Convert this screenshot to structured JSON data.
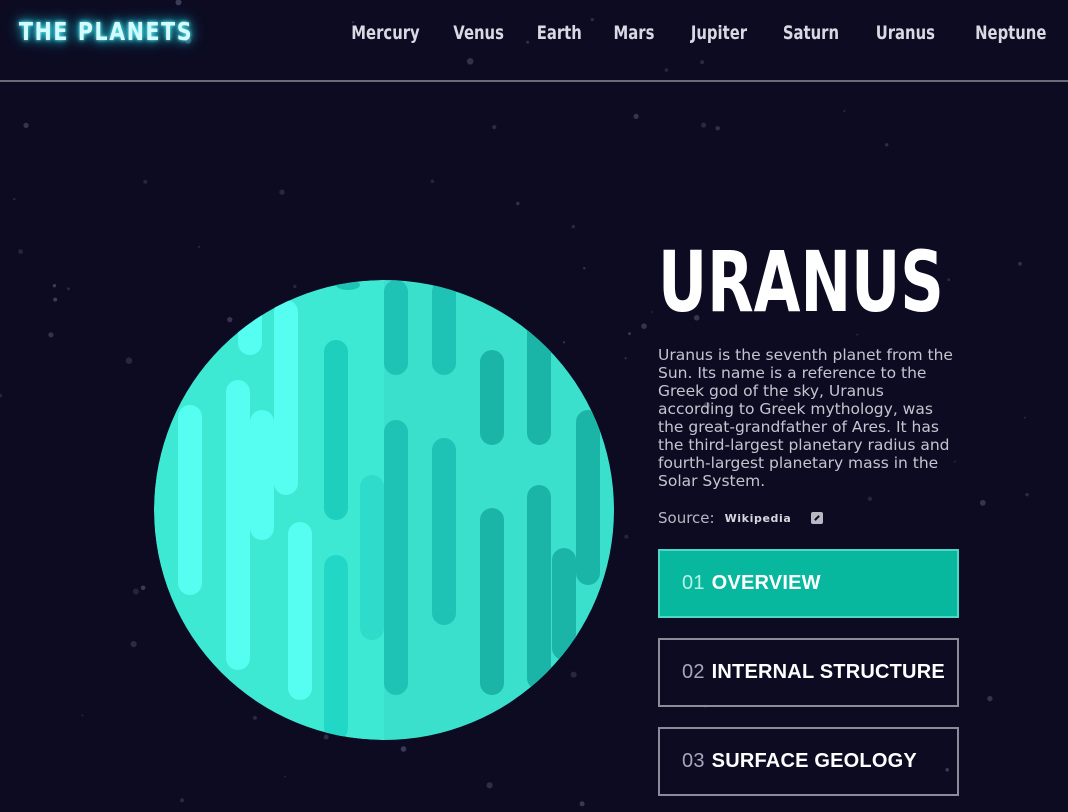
{
  "header": {
    "logo": "THE PLANETS",
    "nav": [
      "Mercury",
      "Venus",
      "Earth",
      "Mars",
      "Jupiter",
      "Saturn",
      "Uranus",
      "Neptune"
    ]
  },
  "planet": {
    "name": "URANUS",
    "description": "Uranus is the seventh planet from the Sun. Its name is a reference to the Greek god of the sky, Uranus according to Greek mythology, was the great-grandfather of Ares. It has the third-largest planetary radius and fourth-largest planetary mass in the Solar System.",
    "source_label": "Source:",
    "source_link": "Wikipedia",
    "image_icon": "uranus-planet-illustration"
  },
  "tabs": [
    {
      "num": "01",
      "label": "OVERVIEW",
      "active": true
    },
    {
      "num": "02",
      "label": "INTERNAL STRUCTURE",
      "active": false
    },
    {
      "num": "03",
      "label": "SURFACE GEOLOGY",
      "active": false
    }
  ],
  "colors": {
    "background": "#0c0b22",
    "accent": "#07b89e",
    "planet_base": "#3de9d2",
    "planet_light": "#56fef1",
    "planet_dark": "#1fbfb0"
  },
  "icons": {
    "external_link": "external-link-icon"
  }
}
